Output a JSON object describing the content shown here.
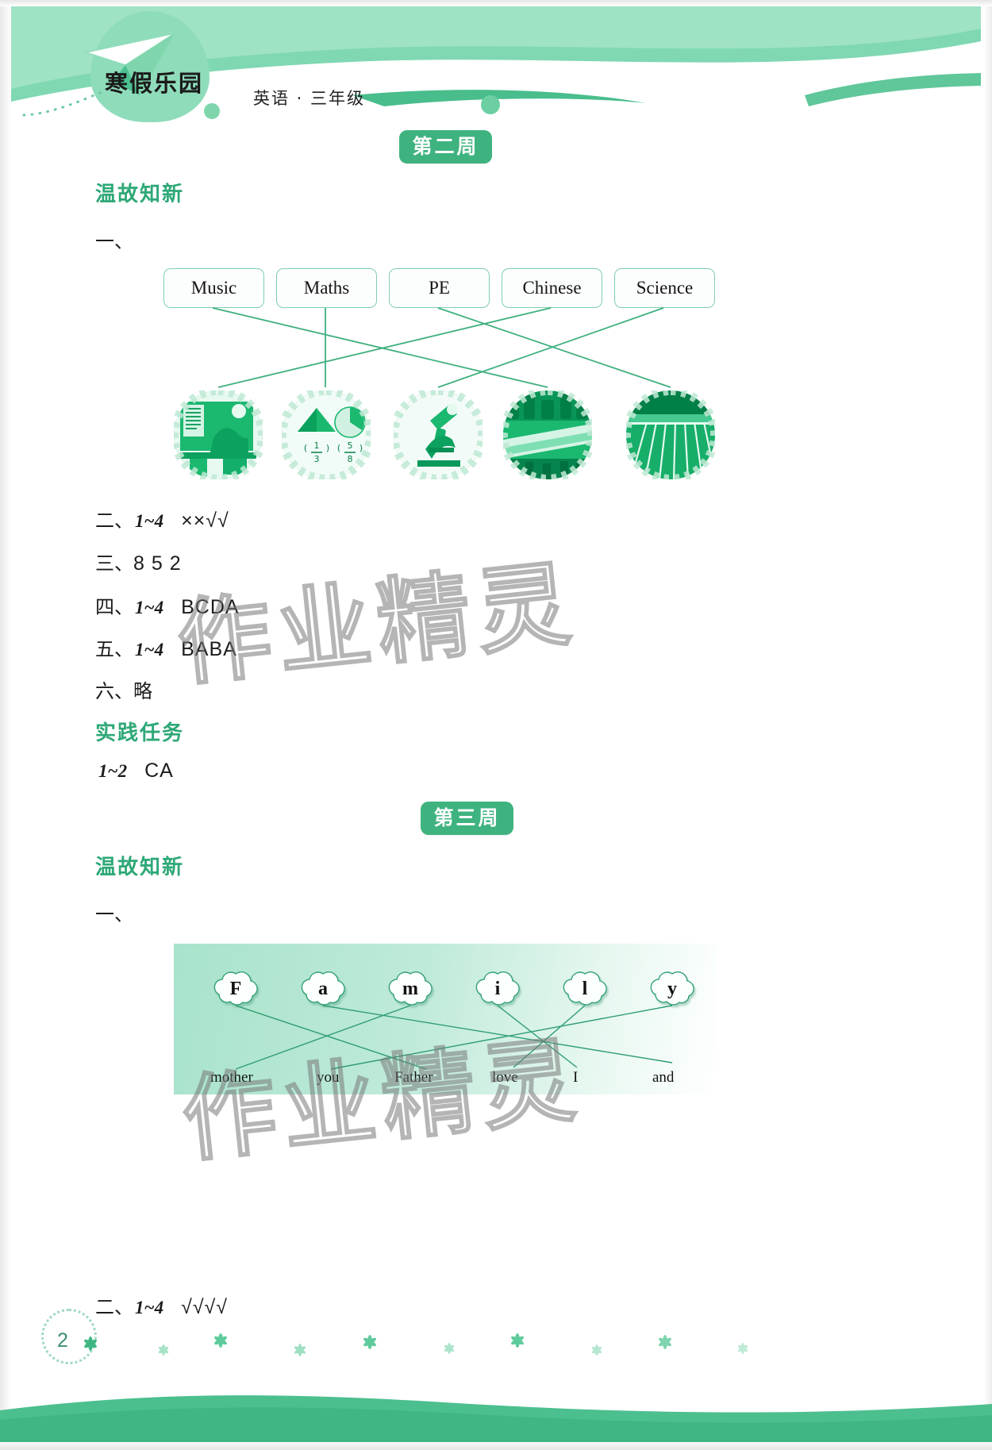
{
  "document": {
    "book_title": "寒假乐园",
    "subtitle": "英语 · 三年级",
    "page_number": "2"
  },
  "colors": {
    "brand_green": "#2ea877",
    "badge_green": "#3fb37f",
    "box_border": "#7fcfae",
    "panel_mint": "#a8e3cb",
    "image_green": "#36b87c"
  },
  "week2": {
    "badge": "第二周",
    "review_head": "温故知新",
    "q1_num": "一、",
    "subjects": [
      {
        "label": "Music"
      },
      {
        "label": "Maths"
      },
      {
        "label": "PE"
      },
      {
        "label": "Chinese"
      },
      {
        "label": "Science"
      }
    ],
    "pictures": [
      {
        "name": "classroom-chinese-lesson-photo"
      },
      {
        "name": "maths-fractions-diagram-photo"
      },
      {
        "name": "microscope-science-photo"
      },
      {
        "name": "music-band-instruments-photo"
      },
      {
        "name": "running-track-pe-photo"
      }
    ],
    "answers": [
      {
        "num": "二、",
        "range": "1~4",
        "value": "××√√"
      },
      {
        "num": "三、",
        "range": "",
        "value": "8   5   2"
      },
      {
        "num": "四、",
        "range": "1~4",
        "value": "BCDA"
      },
      {
        "num": "五、",
        "range": "1~4",
        "value": "BABA"
      },
      {
        "num": "六、",
        "range": "",
        "value": "略"
      }
    ],
    "practice_head": "实践任务",
    "practice_range": "1~2",
    "practice_value": "CA"
  },
  "week3": {
    "badge": "第三周",
    "review_head": "温故知新",
    "q1_num": "一、",
    "letters": [
      "F",
      "a",
      "m",
      "i",
      "l",
      "y"
    ],
    "words": [
      "mother",
      "you",
      "Father",
      "love",
      "I",
      "and"
    ],
    "answers": [
      {
        "num": "二、",
        "range": "1~4",
        "value": "√√√√"
      }
    ]
  },
  "watermark": {
    "text": "作业精灵"
  }
}
